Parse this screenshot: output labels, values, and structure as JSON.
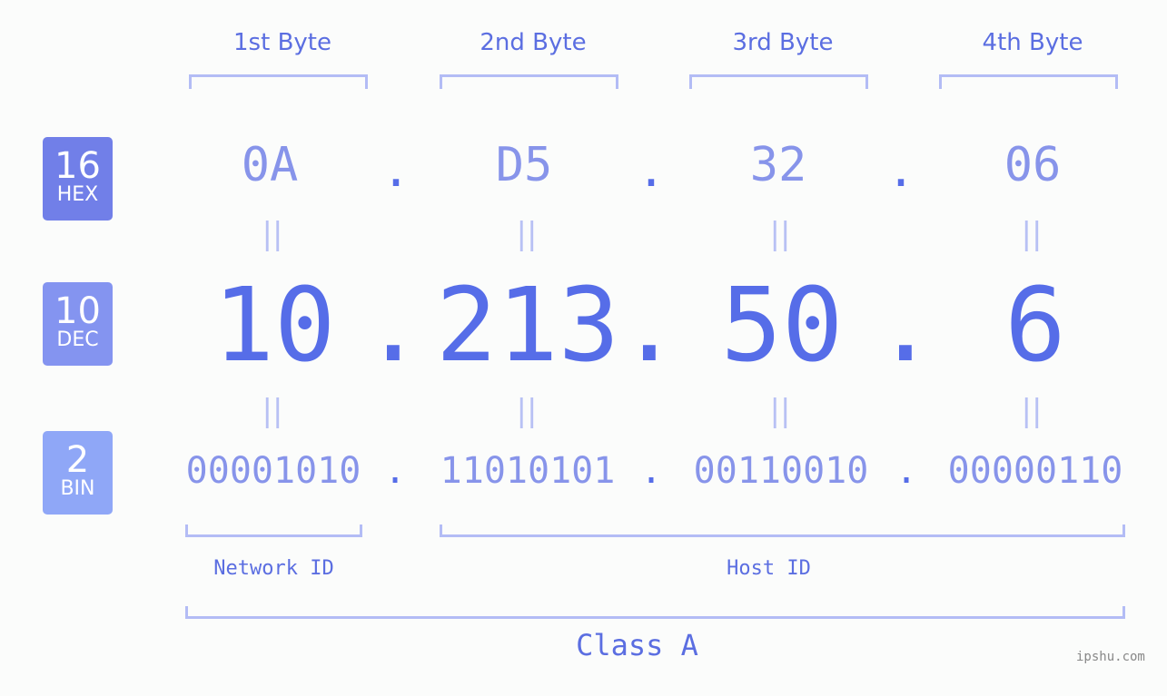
{
  "byte_headers": [
    "1st Byte",
    "2nd Byte",
    "3rd Byte",
    "4th Byte"
  ],
  "bases": [
    {
      "number": "16",
      "label": "HEX",
      "color": "#717fe8"
    },
    {
      "number": "10",
      "label": "DEC",
      "color": "#8494f0"
    },
    {
      "number": "2",
      "label": "BIN",
      "color": "#8fa7f7"
    }
  ],
  "hex": [
    "0A",
    "D5",
    "32",
    "06"
  ],
  "dec": [
    "10",
    "213",
    "50",
    "6"
  ],
  "bin": [
    "00001010",
    "11010101",
    "00110010",
    "00000110"
  ],
  "separator": ".",
  "equals": "||",
  "network_label": "Network ID",
  "host_label": "Host ID",
  "class_label": "Class A",
  "watermark": "ipshu.com"
}
